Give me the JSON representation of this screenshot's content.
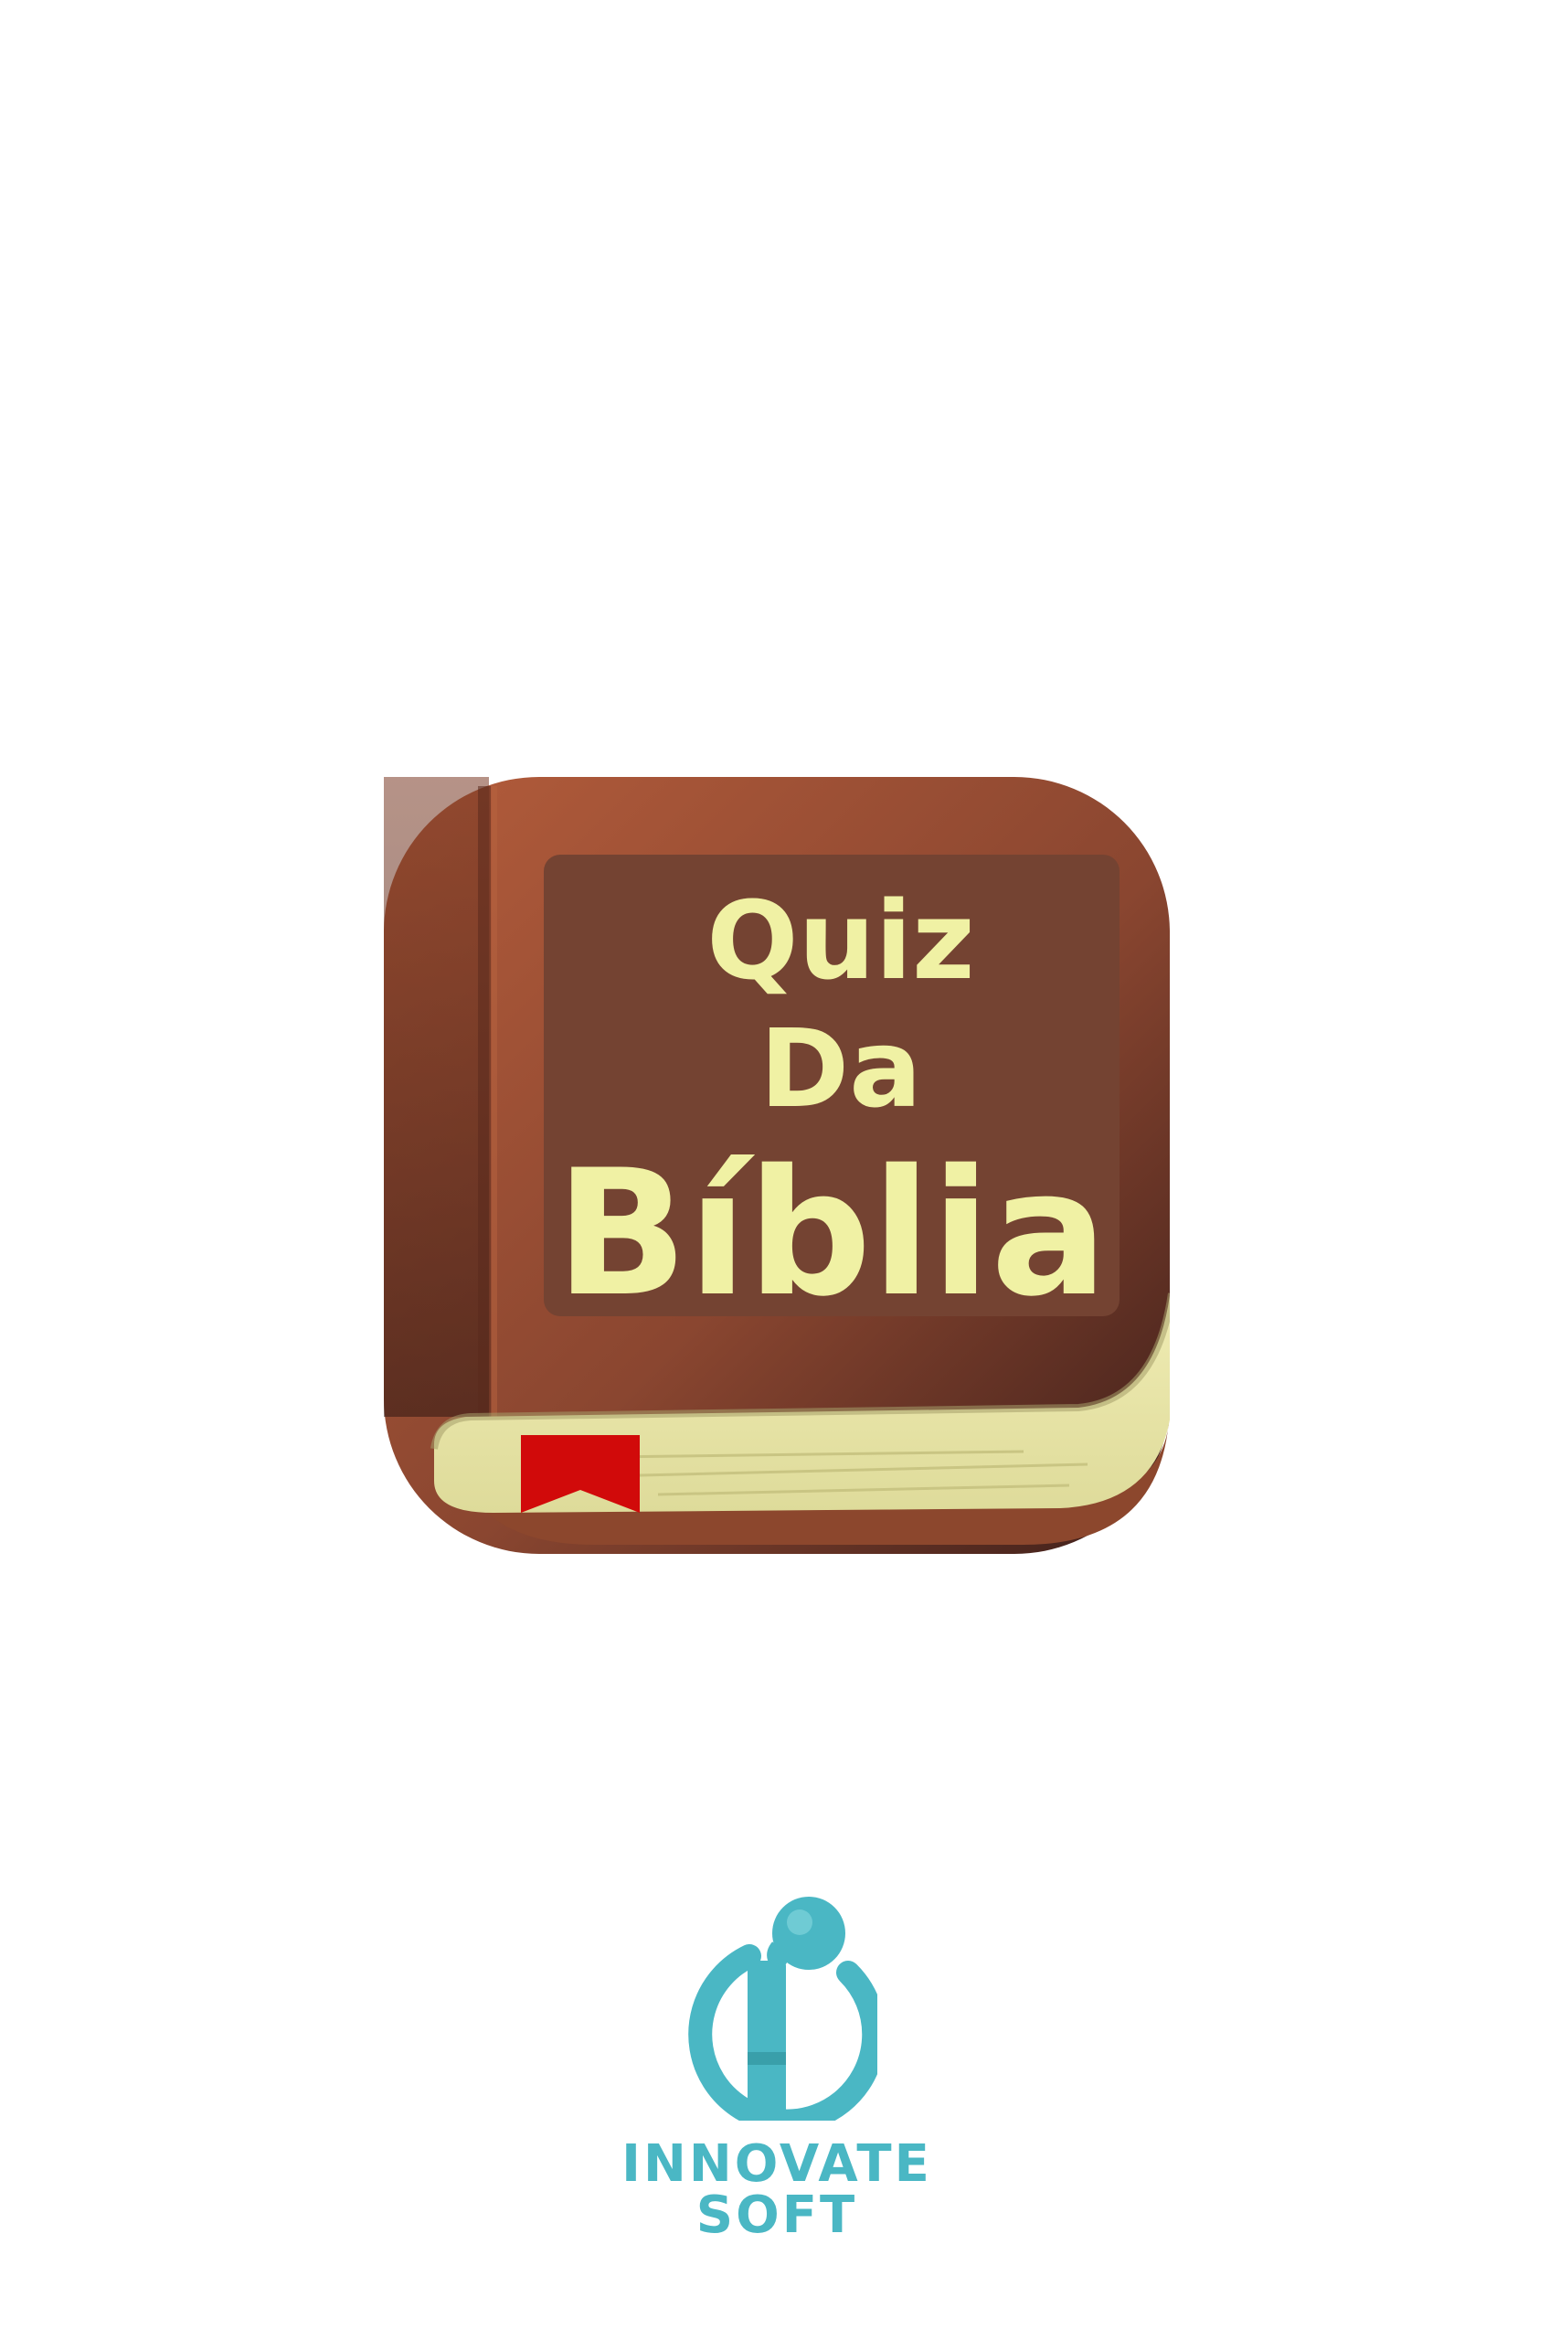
{
  "splash": {
    "app_icon": {
      "title_lines": [
        "Quiz",
        "Da",
        "Bíblia"
      ],
      "colors": {
        "cover_light": "#a8573a",
        "cover_dark": "#5e2f24",
        "label_panel": "#744332",
        "title_text": "#f0f1a4",
        "pages": "#e9e6a6",
        "bookmark": "#d10a0a"
      }
    },
    "brand": {
      "name": "INNOVATE SOFT",
      "logo_icon": "innovate-soft-logo-icon",
      "color": "#4ab7c4"
    }
  }
}
